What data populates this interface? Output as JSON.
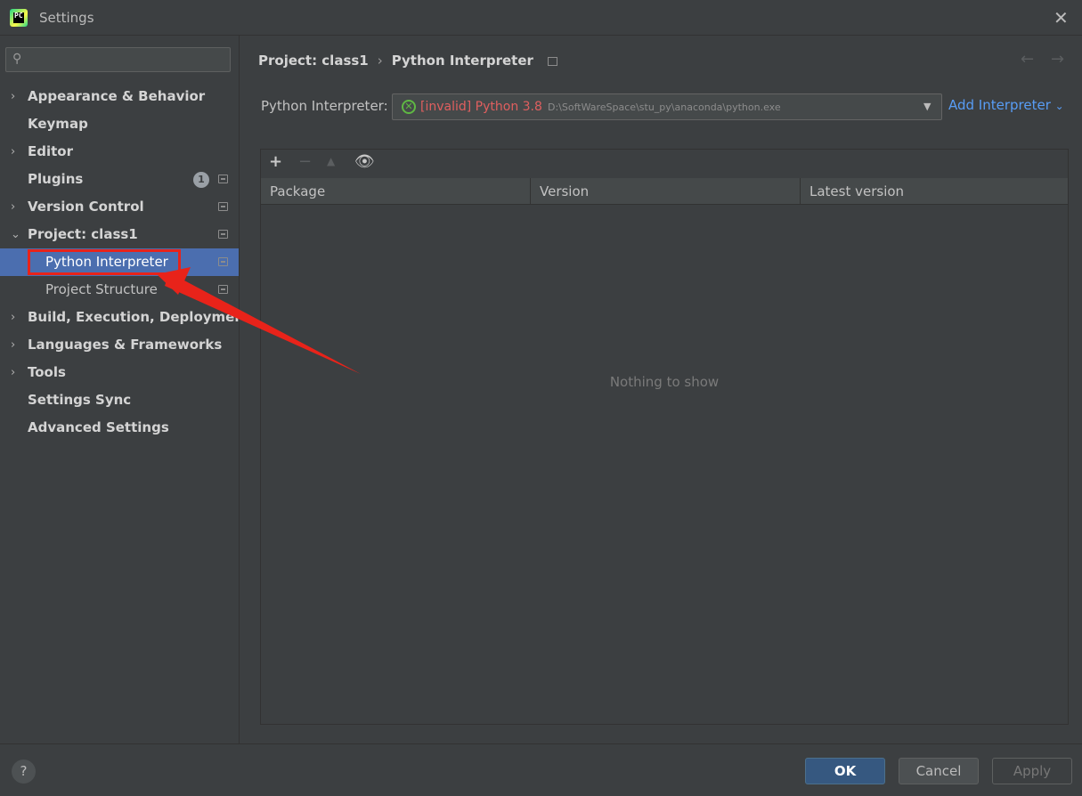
{
  "window": {
    "title": "Settings",
    "app_icon_text": "PC"
  },
  "search": {
    "placeholder": ""
  },
  "sidebar": {
    "items": [
      {
        "label": "Appearance & Behavior",
        "expandable": true,
        "expanded": false
      },
      {
        "label": "Keymap",
        "expandable": false
      },
      {
        "label": "Editor",
        "expandable": true,
        "expanded": false
      },
      {
        "label": "Plugins",
        "expandable": false,
        "badge": "1"
      },
      {
        "label": "Version Control",
        "expandable": true,
        "expanded": false
      },
      {
        "label": "Project: class1",
        "expandable": true,
        "expanded": true
      },
      {
        "label": "Python Interpreter",
        "child": true,
        "selected": true
      },
      {
        "label": "Project Structure",
        "child": true
      },
      {
        "label": "Build, Execution, Deployment",
        "expandable": true,
        "expanded": false
      },
      {
        "label": "Languages & Frameworks",
        "expandable": true,
        "expanded": false
      },
      {
        "label": "Tools",
        "expandable": true,
        "expanded": false
      },
      {
        "label": "Settings Sync",
        "expandable": false
      },
      {
        "label": "Advanced Settings",
        "expandable": false
      }
    ]
  },
  "breadcrumb": {
    "parent": "Project: class1",
    "separator": "›",
    "current": "Python Interpreter"
  },
  "interpreter": {
    "label": "Python Interpreter:",
    "status": "[invalid] Python 3.8",
    "path": "D:\\SoftWareSpace\\stu_py\\anaconda\\python.exe"
  },
  "add_interpreter": {
    "label": "Add Interpreter"
  },
  "packages": {
    "columns": [
      "Package",
      "Version",
      "Latest version"
    ],
    "rows": [],
    "empty_text": "Nothing to show"
  },
  "buttons": {
    "ok": "OK",
    "cancel": "Cancel",
    "apply": "Apply",
    "help": "?"
  },
  "colors": {
    "selection": "#4b6eaf",
    "invalid_text": "#e05f5f",
    "link": "#589df6",
    "annotation": "#e8231a",
    "ok_button": "#365880"
  },
  "icons": [
    "search-icon",
    "close-icon",
    "chevron-right-icon",
    "chevron-down-icon",
    "settings-doc-icon",
    "add-icon",
    "remove-icon",
    "upgrade-icon",
    "eye-icon",
    "invalid-interpreter-icon",
    "back-arrow-icon",
    "forward-arrow-icon",
    "help-icon"
  ]
}
